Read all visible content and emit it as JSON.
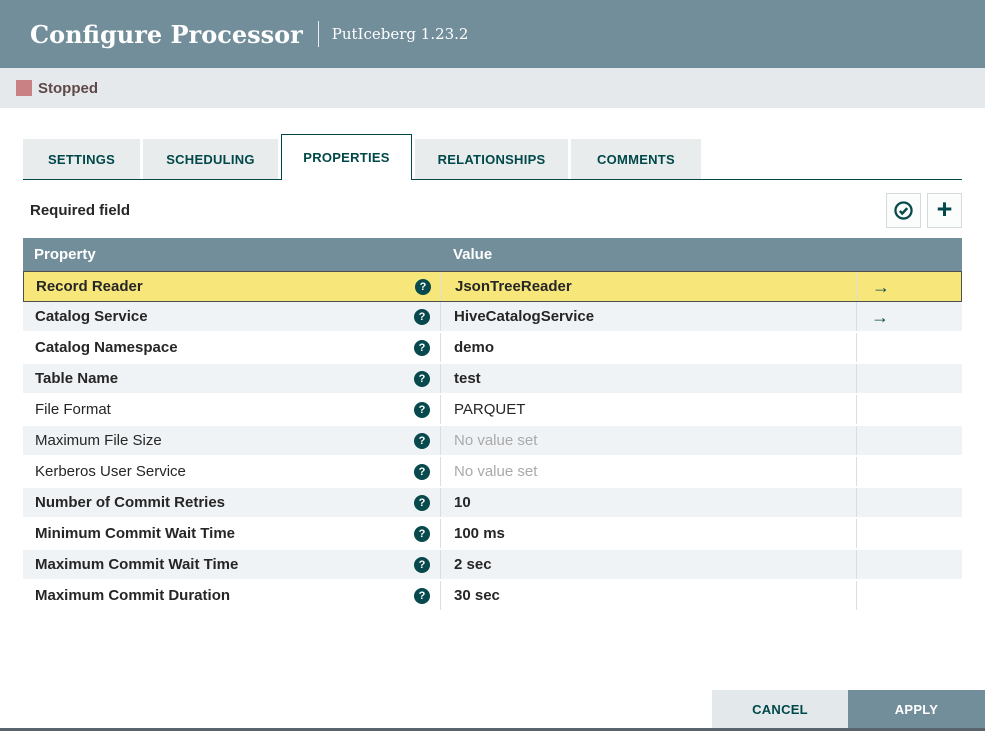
{
  "dialog": {
    "title": "Configure Processor",
    "subtitle": "PutIceberg 1.23.2",
    "status_label": "Stopped"
  },
  "tabs": [
    {
      "label": "SETTINGS",
      "active": false
    },
    {
      "label": "SCHEDULING",
      "active": false
    },
    {
      "label": "PROPERTIES",
      "active": true
    },
    {
      "label": "RELATIONSHIPS",
      "active": false
    },
    {
      "label": "COMMENTS",
      "active": false
    }
  ],
  "toolbar": {
    "required_field_label": "Required field",
    "verify_icon": "circle-check",
    "add_icon": "plus",
    "plus_glyph": "+"
  },
  "table": {
    "columns": {
      "property": "Property",
      "value": "Value"
    },
    "help_glyph": "?",
    "goto_glyph": "→",
    "rows": [
      {
        "property": "Record Reader",
        "value": "JsonTreeReader",
        "bold": true,
        "value_set": true,
        "link": true,
        "selected": true
      },
      {
        "property": "Catalog Service",
        "value": "HiveCatalogService",
        "bold": true,
        "value_set": true,
        "link": true,
        "selected": false
      },
      {
        "property": "Catalog Namespace",
        "value": "demo",
        "bold": true,
        "value_set": true,
        "link": false,
        "selected": false
      },
      {
        "property": "Table Name",
        "value": "test",
        "bold": true,
        "value_set": true,
        "link": false,
        "selected": false
      },
      {
        "property": "File Format",
        "value": "PARQUET",
        "bold": false,
        "value_set": true,
        "link": false,
        "selected": false
      },
      {
        "property": "Maximum File Size",
        "value": "No value set",
        "bold": false,
        "value_set": false,
        "link": false,
        "selected": false
      },
      {
        "property": "Kerberos User Service",
        "value": "No value set",
        "bold": false,
        "value_set": false,
        "link": false,
        "selected": false
      },
      {
        "property": "Number of Commit Retries",
        "value": "10",
        "bold": true,
        "value_set": true,
        "link": false,
        "selected": false
      },
      {
        "property": "Minimum Commit Wait Time",
        "value": "100 ms",
        "bold": true,
        "value_set": true,
        "link": false,
        "selected": false
      },
      {
        "property": "Maximum Commit Wait Time",
        "value": "2 sec",
        "bold": true,
        "value_set": true,
        "link": false,
        "selected": false
      },
      {
        "property": "Maximum Commit Duration",
        "value": "30 sec",
        "bold": true,
        "value_set": true,
        "link": false,
        "selected": false
      }
    ]
  },
  "footer": {
    "cancel_label": "CANCEL",
    "apply_label": "APPLY"
  },
  "colors": {
    "accent_teal": "#004849",
    "header_blue_gray": "#728e9b",
    "selected_row_yellow": "#f7e77a",
    "stopped_icon": "#ca8184",
    "alt_row": "#f0f3f5"
  }
}
